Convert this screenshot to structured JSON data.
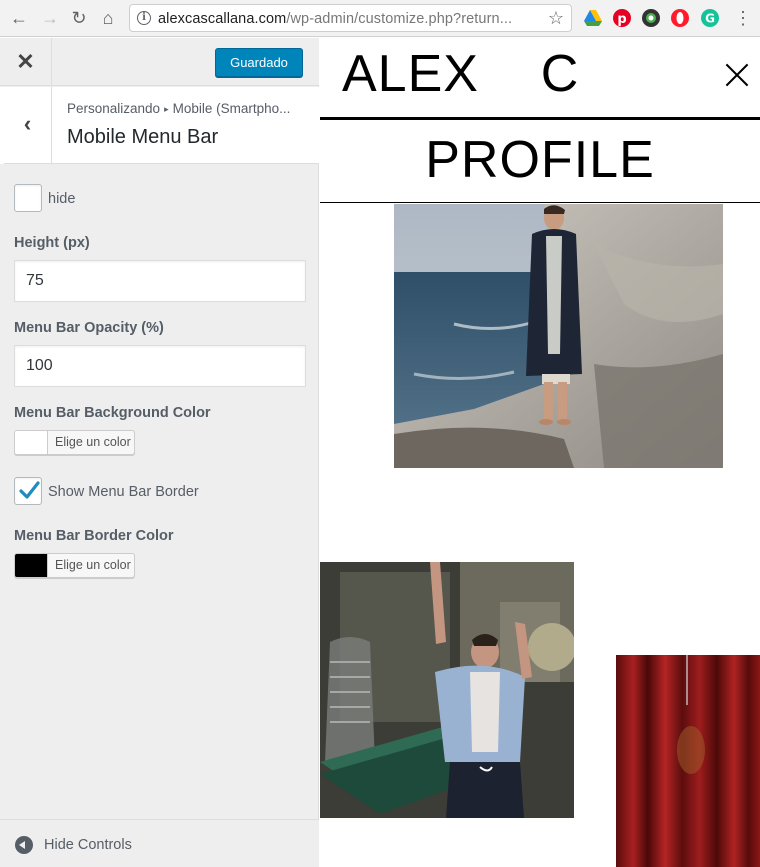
{
  "browser": {
    "url_domain": "alexcascallana.com",
    "url_rest": "/wp-admin/customize.php?return..."
  },
  "customizer": {
    "save_label": "Guardado",
    "breadcrumb_parent": "Personalizando",
    "breadcrumb_child": "Mobile (Smartpho...",
    "section_title": "Mobile Menu Bar",
    "hide_label": "hide",
    "height_label": "Height (px)",
    "height_value": "75",
    "opacity_label": "Menu Bar Opacity (%)",
    "opacity_value": "100",
    "bg_color_label": "Menu Bar Background Color",
    "bg_color_button": "Elige un color",
    "bg_color_value": "#ffffff",
    "show_border_label": "Show Menu Bar Border",
    "show_border_checked": true,
    "border_color_label": "Menu Bar Border Color",
    "border_color_button": "Elige un color",
    "border_color_value": "#000000",
    "hide_controls_label": "Hide Controls"
  },
  "preview": {
    "logo": "ALEX    C",
    "page_title": "PROFILE"
  },
  "colors": {
    "accent": "#0085ba",
    "checkmark": "#1e8cbe"
  }
}
